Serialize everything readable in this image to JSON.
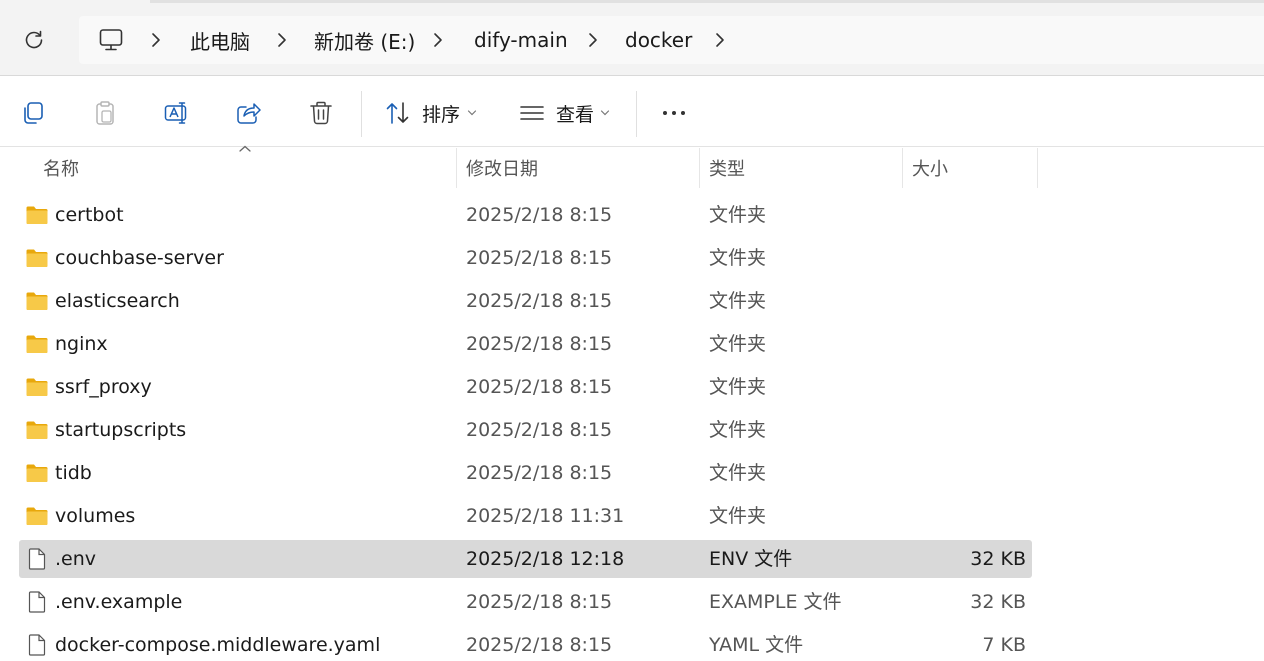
{
  "breadcrumb": {
    "items": [
      {
        "label": "此电脑"
      },
      {
        "label": "新加卷 (E:)"
      },
      {
        "label": "dify-main"
      },
      {
        "label": "docker"
      }
    ]
  },
  "toolbar": {
    "sort_label": "排序",
    "view_label": "查看"
  },
  "columns": {
    "name": "名称",
    "date": "修改日期",
    "type": "类型",
    "size": "大小"
  },
  "files": [
    {
      "name": "certbot",
      "date": "2025/2/18 8:15",
      "type": "文件夹",
      "size": "",
      "kind": "folder"
    },
    {
      "name": "couchbase-server",
      "date": "2025/2/18 8:15",
      "type": "文件夹",
      "size": "",
      "kind": "folder"
    },
    {
      "name": "elasticsearch",
      "date": "2025/2/18 8:15",
      "type": "文件夹",
      "size": "",
      "kind": "folder"
    },
    {
      "name": "nginx",
      "date": "2025/2/18 8:15",
      "type": "文件夹",
      "size": "",
      "kind": "folder"
    },
    {
      "name": "ssrf_proxy",
      "date": "2025/2/18 8:15",
      "type": "文件夹",
      "size": "",
      "kind": "folder"
    },
    {
      "name": "startupscripts",
      "date": "2025/2/18 8:15",
      "type": "文件夹",
      "size": "",
      "kind": "folder"
    },
    {
      "name": "tidb",
      "date": "2025/2/18 8:15",
      "type": "文件夹",
      "size": "",
      "kind": "folder"
    },
    {
      "name": "volumes",
      "date": "2025/2/18 11:31",
      "type": "文件夹",
      "size": "",
      "kind": "folder"
    },
    {
      "name": ".env",
      "date": "2025/2/18 12:18",
      "type": "ENV 文件",
      "size": "32 KB",
      "kind": "file",
      "selected": true
    },
    {
      "name": ".env.example",
      "date": "2025/2/18 8:15",
      "type": "EXAMPLE 文件",
      "size": "32 KB",
      "kind": "file"
    },
    {
      "name": "docker-compose.middleware.yaml",
      "date": "2025/2/18 8:15",
      "type": "YAML 文件",
      "size": "7 KB",
      "kind": "file"
    }
  ],
  "icons": {
    "refresh": "refresh-icon",
    "pc": "computer-icon",
    "chevron": "chevron-right-icon",
    "copy": "copy-icon",
    "paste": "paste-icon",
    "rename": "rename-icon",
    "share": "share-icon",
    "delete": "trash-icon",
    "sort": "sort-icon",
    "view": "view-icon",
    "more": "more-icon",
    "folder": "folder-icon",
    "file": "file-icon"
  },
  "colors": {
    "folder": "#f7c948",
    "folder_dark": "#e8a80c",
    "selection": "#d9d9d9",
    "accent": "#1a5fb4"
  }
}
